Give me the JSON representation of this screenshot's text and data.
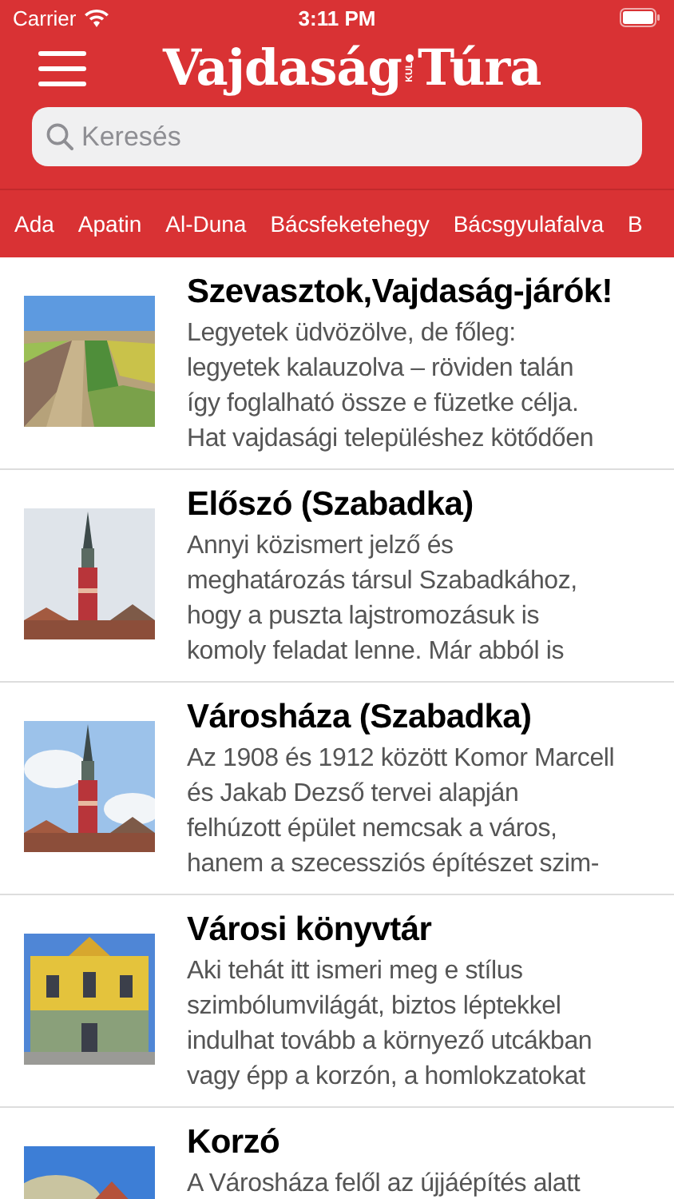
{
  "status_bar": {
    "carrier": "Carrier",
    "time": "3:11 PM"
  },
  "header": {
    "logo": {
      "left": "Vajdaság",
      "middle": "KUL",
      "right": "Túra"
    }
  },
  "search": {
    "placeholder": "Keresés"
  },
  "categories": [
    {
      "label": "Ada"
    },
    {
      "label": "Apatin"
    },
    {
      "label": "Al-Duna"
    },
    {
      "label": "Bácsfeketehegy"
    },
    {
      "label": "Bácsgyulafalva"
    },
    {
      "label": "B"
    }
  ],
  "articles": [
    {
      "title": "Szevasztok,Vajdaság-járók!",
      "lines": [
        "Legyetek üdvözölve, de főleg:",
        "legyetek kalauzolva – röviden talán",
        "így foglalható össze e füzetke célja.",
        "Hat vajdasági településhez kötődően"
      ]
    },
    {
      "title": "Előszó (Szabadka)",
      "lines": [
        "Annyi közismert jelző és",
        "meghatározás társul Szabadkához,",
        "hogy a puszta lajstromozásuk is",
        "komoly feladat lenne. Már abból is"
      ]
    },
    {
      "title": "Városháza (Szabadka)",
      "lines": [
        "Az 1908 és 1912 között Komor Marcell",
        "és Jakab Dezső tervei alapján",
        "felhúzott épület nemcsak a város,",
        "hanem a szecessziós építészet szim-"
      ]
    },
    {
      "title": "Városi könyvtár",
      "lines": [
        "Aki tehát itt ismeri meg e stílus",
        "szimbólumvilágát, biztos léptekkel",
        "indulhat tovább a környező utcákban",
        "vagy épp a korzón, a homlokzatokat"
      ]
    },
    {
      "title": "Korzó",
      "lines": [
        "A Városháza felől az újjáépítés alatt"
      ]
    }
  ]
}
